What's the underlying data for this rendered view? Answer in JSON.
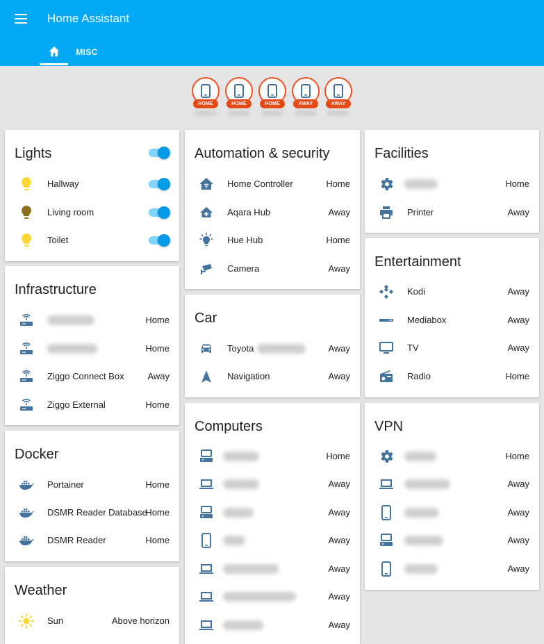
{
  "app": {
    "title": "Home Assistant"
  },
  "tabs": [
    {
      "icon": "home-icon"
    },
    {
      "label": "MISC"
    }
  ],
  "badges": [
    {
      "state": "HOME",
      "icon": "cellphone-icon"
    },
    {
      "state": "HOME",
      "icon": "cellphone-icon"
    },
    {
      "state": "HOME",
      "icon": "cellphone-icon"
    },
    {
      "state": "AWAY",
      "icon": "cellphone-icon"
    },
    {
      "state": "AWAY",
      "icon": "cellphone-icon"
    }
  ],
  "colors": {
    "header": "#03a9f4",
    "icon": "#44739e",
    "badge": "#e64a19",
    "toggle": "#039be5",
    "bulb_on": "#fdd835",
    "bulb_dim": "#8d6e19",
    "sun": "#fdd835"
  },
  "lights": {
    "title": "Lights",
    "items": [
      {
        "name": "Hallway",
        "icon": "lightbulb-icon"
      },
      {
        "name": "Living room",
        "icon": "lightbulb-icon"
      },
      {
        "name": "Toilet",
        "icon": "lightbulb-icon"
      }
    ]
  },
  "infrastructure": {
    "title": "Infrastructure",
    "items": [
      {
        "name": "",
        "state": "Home",
        "icon": "router-icon"
      },
      {
        "name": "",
        "state": "Home",
        "icon": "router-icon"
      },
      {
        "name": "Ziggo Connect Box",
        "state": "Away",
        "icon": "router-icon"
      },
      {
        "name": "Ziggo External",
        "state": "Home",
        "icon": "router-icon"
      }
    ]
  },
  "docker": {
    "title": "Docker",
    "items": [
      {
        "name": "Portainer",
        "state": "Home",
        "icon": "docker-icon"
      },
      {
        "name": "DSMR Reader Database",
        "state": "Home",
        "icon": "docker-icon"
      },
      {
        "name": "DSMR Reader",
        "state": "Home",
        "icon": "docker-icon"
      }
    ]
  },
  "weather": {
    "title": "Weather",
    "items": [
      {
        "name": "Sun",
        "state": "Above horizon",
        "icon": "sun-icon"
      }
    ]
  },
  "automation": {
    "title": "Automation & security",
    "items": [
      {
        "name": "Home Controller",
        "state": "Home",
        "icon": "home-automation-icon"
      },
      {
        "name": "Aqara Hub",
        "state": "Away",
        "icon": "home-plus-icon"
      },
      {
        "name": "Hue Hub",
        "state": "Home",
        "icon": "lightbulb-hub-icon"
      },
      {
        "name": "Camera",
        "state": "Away",
        "icon": "cctv-icon"
      }
    ]
  },
  "car": {
    "title": "Car",
    "items": [
      {
        "name": "Toyota",
        "state": "Away",
        "icon": "car-icon"
      },
      {
        "name": "Navigation",
        "state": "Away",
        "icon": "navigation-icon"
      }
    ]
  },
  "computers": {
    "title": "Computers",
    "items": [
      {
        "name": "",
        "state": "Home",
        "icon": "server-icon"
      },
      {
        "name": "",
        "state": "Away",
        "icon": "laptop-icon"
      },
      {
        "name": "",
        "state": "Away",
        "icon": "server-icon"
      },
      {
        "name": "",
        "state": "Away",
        "icon": "cellphone-icon"
      },
      {
        "name": "",
        "state": "Away",
        "icon": "laptop-icon"
      },
      {
        "name": "",
        "state": "Away",
        "icon": "laptop-icon"
      },
      {
        "name": "",
        "state": "Away",
        "icon": "laptop-icon"
      }
    ]
  },
  "facilities": {
    "title": "Facilities",
    "items": [
      {
        "name": "",
        "state": "Home",
        "icon": "settings-icon"
      },
      {
        "name": "Printer",
        "state": "Away",
        "icon": "printer-icon"
      }
    ]
  },
  "entertainment": {
    "title": "Entertainment",
    "items": [
      {
        "name": "Kodi",
        "state": "Away",
        "icon": "kodi-icon"
      },
      {
        "name": "Mediabox",
        "state": "Away",
        "icon": "set-top-box-icon"
      },
      {
        "name": "TV",
        "state": "Away",
        "icon": "monitor-icon"
      },
      {
        "name": "Radio",
        "state": "Home",
        "icon": "radio-icon"
      }
    ]
  },
  "vpn": {
    "title": "VPN",
    "items": [
      {
        "name": "",
        "state": "Home",
        "icon": "settings-icon"
      },
      {
        "name": "",
        "state": "Away",
        "icon": "laptop-icon"
      },
      {
        "name": "",
        "state": "Away",
        "icon": "cellphone-icon"
      },
      {
        "name": "",
        "state": "Away",
        "icon": "server-icon"
      },
      {
        "name": "",
        "state": "Away",
        "icon": "cellphone-icon"
      }
    ]
  }
}
